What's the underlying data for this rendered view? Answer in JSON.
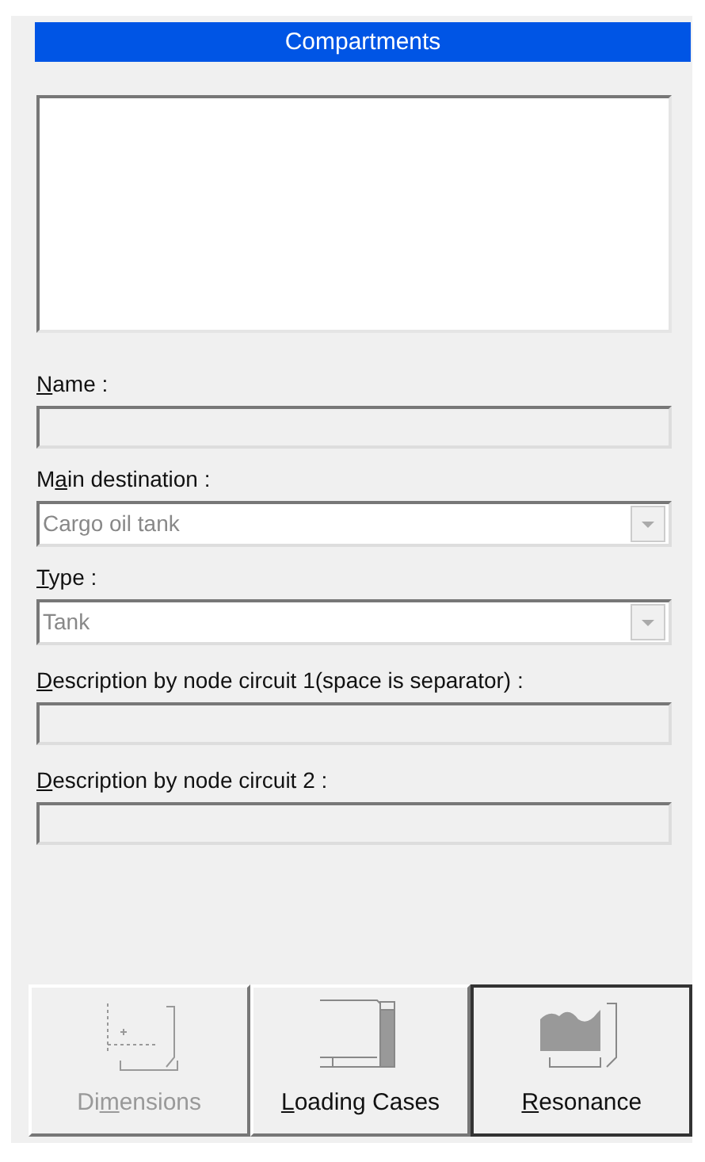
{
  "panel": {
    "title": "Compartments"
  },
  "fields": [
    {
      "kind": "text",
      "label": {
        "key": "N",
        "after": "ame :"
      },
      "disabled": true
    },
    {
      "kind": "combo",
      "label": {
        "before": "M",
        "key": "a",
        "after": "in destination :"
      },
      "value": "Cargo oil tank",
      "disabled": true
    },
    {
      "kind": "combo",
      "label": {
        "key": "T",
        "after": "ype :"
      },
      "value": "Tank",
      "disabled": true
    },
    {
      "kind": "text",
      "label": {
        "key": "D",
        "after": "escription by node circuit 1(space is separator) :"
      },
      "disabled": true
    },
    {
      "kind": "text",
      "label": {
        "key": "D",
        "after": "escription by node circuit 2 :"
      },
      "disabled": true
    }
  ],
  "buttons": [
    {
      "kind": "dimensions",
      "label": {
        "before": "Di",
        "key": "m",
        "after": "ensions"
      },
      "disabled": true,
      "selected": false
    },
    {
      "kind": "loading",
      "label": {
        "key": "L",
        "after": "oading Cases"
      },
      "disabled": false,
      "selected": false
    },
    {
      "kind": "resonance",
      "label": {
        "key": "R",
        "after": "esonance"
      },
      "disabled": false,
      "selected": true
    }
  ]
}
